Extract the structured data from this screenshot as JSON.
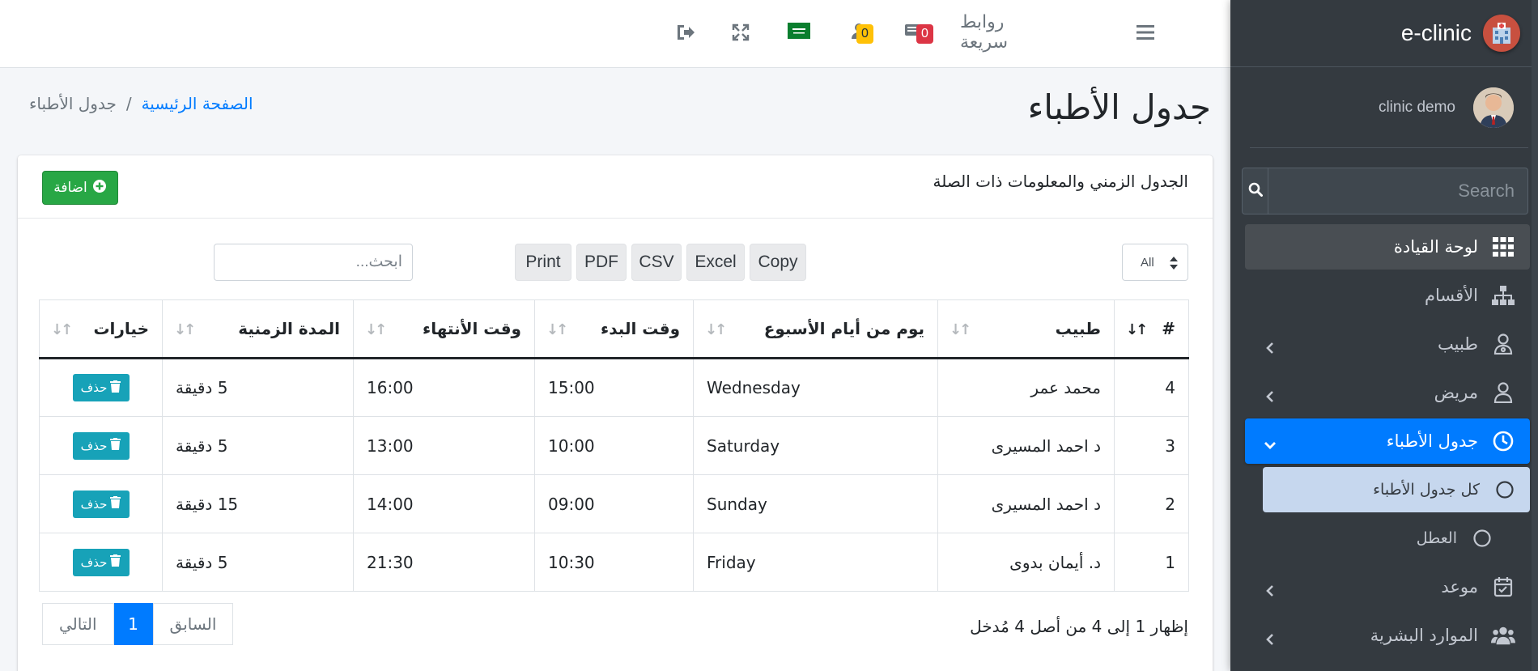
{
  "app": {
    "brand_name": "e-clinic",
    "user_name": "clinic demo"
  },
  "sidebar": {
    "search_placeholder": "Search",
    "items": [
      {
        "label": "لوحة القيادة",
        "icon": "dashboard-grid-icon"
      },
      {
        "label": "الأقسام",
        "icon": "sitemap-icon"
      },
      {
        "label": "طبيب",
        "icon": "doctor-icon"
      },
      {
        "label": "مريض",
        "icon": "user-icon"
      },
      {
        "label": "جدول الأطباء",
        "icon": "clock-icon"
      },
      {
        "label": "كل جدول الأطباء",
        "icon": "circle-icon"
      },
      {
        "label": "العطل",
        "icon": "circle-icon"
      },
      {
        "label": "موعد",
        "icon": "calendar-check-icon"
      },
      {
        "label": "الموارد البشرية",
        "icon": "users-icon"
      }
    ]
  },
  "topbar": {
    "quick_links": "روابط سريعة",
    "messages_count": "0",
    "users_count": "0",
    "language_flag": "saudi-flag-icon"
  },
  "page": {
    "title": "جدول الأطباء",
    "breadcrumb_home": "الصفحة الرئيسية",
    "breadcrumb_sep": "/",
    "breadcrumb_current": "جدول الأطباء"
  },
  "card": {
    "title": "الجدول الزمني والمعلومات ذات الصلة",
    "add_label": "اضافة"
  },
  "controls": {
    "length_value": "All",
    "export_buttons": [
      "Copy",
      "Excel",
      "CSV",
      "PDF",
      "Print"
    ],
    "search_placeholder": "ابحث..."
  },
  "table": {
    "headers": [
      "#",
      "طبيب",
      "يوم من أيام الأسبوع",
      "وقت البدء",
      "وقت الأنتهاء",
      "المدة الزمنية",
      "خيارات"
    ],
    "rows": [
      {
        "id": "4",
        "doctor": "محمد عمر",
        "day": "Wednesday",
        "start": "15:00",
        "end": "16:00",
        "duration": "5 دقيقة",
        "action": "حذف"
      },
      {
        "id": "3",
        "doctor": "د احمد المسيرى",
        "day": "Saturday",
        "start": "10:00",
        "end": "13:00",
        "duration": "5 دقيقة",
        "action": "حذف"
      },
      {
        "id": "2",
        "doctor": "د احمد المسيرى",
        "day": "Sunday",
        "start": "09:00",
        "end": "14:00",
        "duration": "15 دقيقة",
        "action": "حذف"
      },
      {
        "id": "1",
        "doctor": "د. أيمان بدوى",
        "day": "Friday",
        "start": "10:30",
        "end": "21:30",
        "duration": "5 دقيقة",
        "action": "حذف"
      }
    ]
  },
  "footer": {
    "info": "إظهار 1 إلى 4 من أصل 4 مُدخل",
    "prev": "السابق",
    "page": "1",
    "next": "التالي"
  },
  "colors": {
    "sidebar_bg": "#343a40",
    "primary": "#007bff",
    "success": "#28a745",
    "info": "#17a2b8",
    "danger": "#dc3545",
    "warning": "#ffc107"
  }
}
